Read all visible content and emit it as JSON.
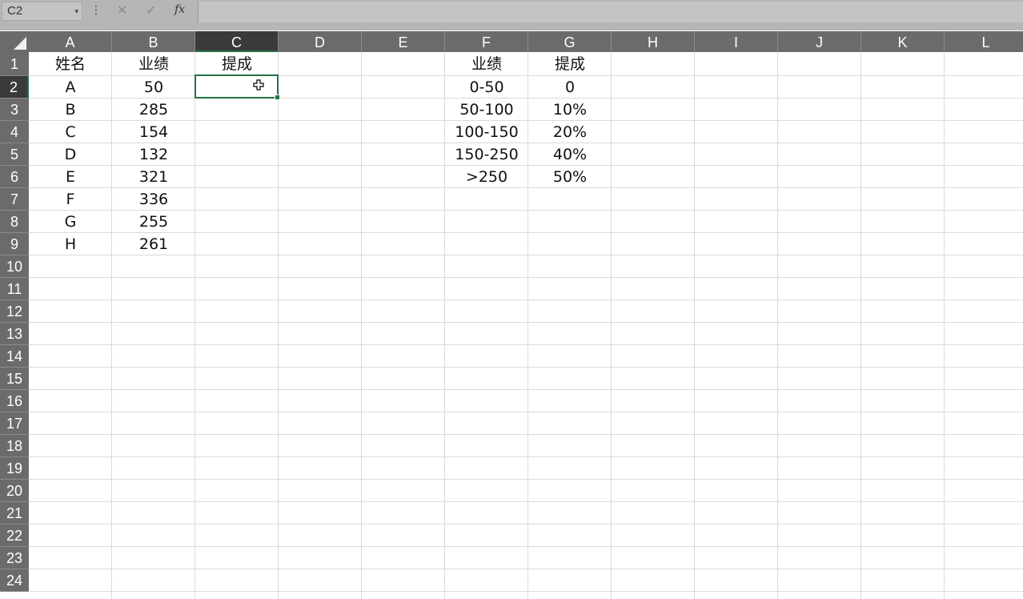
{
  "formula_bar": {
    "name_box": "C2",
    "name_box_dropdown": "▾",
    "more_icon": "⋮",
    "cancel_icon": "✕",
    "enter_icon": "✓",
    "fx_label": "fx",
    "formula": ""
  },
  "columns": [
    "A",
    "B",
    "C",
    "D",
    "E",
    "F",
    "G",
    "H",
    "I",
    "J",
    "K",
    "L"
  ],
  "rows": [
    "1",
    "2",
    "3",
    "4",
    "5",
    "6",
    "7",
    "8",
    "9",
    "10",
    "11",
    "12",
    "13",
    "14",
    "15",
    "16",
    "17",
    "18",
    "19",
    "20",
    "21",
    "22",
    "23",
    "24"
  ],
  "selection": {
    "active_cell": "C2",
    "active_column": "C",
    "active_row": "2"
  },
  "cells": {
    "A1": "姓名",
    "B1": "业绩",
    "C1": "提成",
    "A2": "A",
    "B2": "50",
    "A3": "B",
    "B3": "285",
    "A4": "C",
    "B4": "154",
    "A5": "D",
    "B5": "132",
    "A6": "E",
    "B6": "321",
    "A7": "F",
    "B7": "336",
    "A8": "G",
    "B8": "255",
    "A9": "H",
    "B9": "261",
    "F1": "业绩",
    "G1": "提成",
    "F2": "0-50",
    "G2": "0",
    "F3": "50-100",
    "G3": "10%",
    "F4": "100-150",
    "G4": "20%",
    "F5": "150-250",
    "G5": "40%",
    "F6": ">250",
    "G6": "50%"
  },
  "cursor_icon": "move-cross-icon",
  "colors": {
    "header_bg": "#6b6b6b",
    "selected_header_bg": "#3a3a3a",
    "accent": "#217346",
    "gridline": "#dadada"
  }
}
